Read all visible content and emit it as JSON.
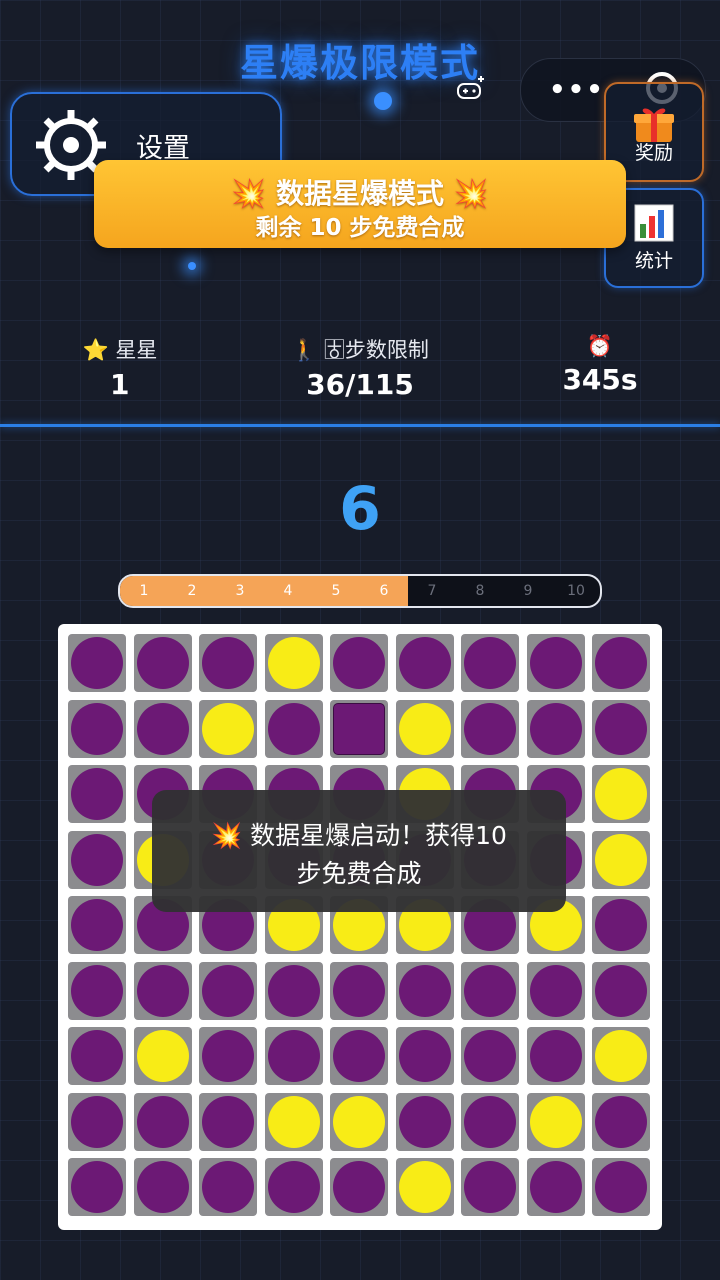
{
  "header": {
    "title": "星爆极限模式",
    "settings_label": "设置",
    "capsule_dots": "•••"
  },
  "side_buttons": {
    "reward_label": "奖励",
    "stats_label": "统计"
  },
  "banner": {
    "line1": "💥 数据星爆模式 💥",
    "line2": "剩余 10 步免费合成"
  },
  "stats": {
    "stars_label": "⭐ 星星",
    "stars_value": "1",
    "steps_label": "🚶 ♁⃞步数限制",
    "steps_value": "36/115",
    "time_label": "⏰",
    "time_value": "345s"
  },
  "level": {
    "current": "6",
    "progress_fraction": 0.6,
    "ticks": [
      "1",
      "2",
      "3",
      "4",
      "5",
      "6",
      "7",
      "8",
      "9",
      "10"
    ],
    "active_count": 6
  },
  "board": {
    "rows": [
      [
        "p",
        "p",
        "p",
        "y",
        "p",
        "p",
        "p",
        "p",
        "p"
      ],
      [
        "p",
        "p",
        "y",
        "p",
        "sq",
        "y",
        "p",
        "p",
        "p"
      ],
      [
        "p",
        "p",
        "p",
        "p",
        "p",
        "y",
        "p",
        "p",
        "y"
      ],
      [
        "p",
        "y",
        "p",
        "p",
        "p",
        "p",
        "p",
        "p",
        "y"
      ],
      [
        "p",
        "p",
        "p",
        "y",
        "y",
        "y",
        "p",
        "y",
        "p"
      ],
      [
        "p",
        "p",
        "p",
        "p",
        "p",
        "p",
        "p",
        "p",
        "p"
      ],
      [
        "p",
        "y",
        "p",
        "p",
        "p",
        "p",
        "p",
        "p",
        "y"
      ],
      [
        "p",
        "p",
        "p",
        "y",
        "y",
        "p",
        "p",
        "y",
        "p"
      ],
      [
        "p",
        "p",
        "p",
        "p",
        "p",
        "y",
        "p",
        "p",
        "p"
      ]
    ],
    "colors": {
      "purple": "#6c1975",
      "yellow": "#f8ec16",
      "slot": "#8c8c8f"
    }
  },
  "toast": {
    "line1": "💥 数据星爆启动！获得10",
    "line2": "步免费合成"
  },
  "colors": {
    "accent": "#2d7ff5",
    "banner": "#ffc534",
    "progress": "#f5a457"
  }
}
